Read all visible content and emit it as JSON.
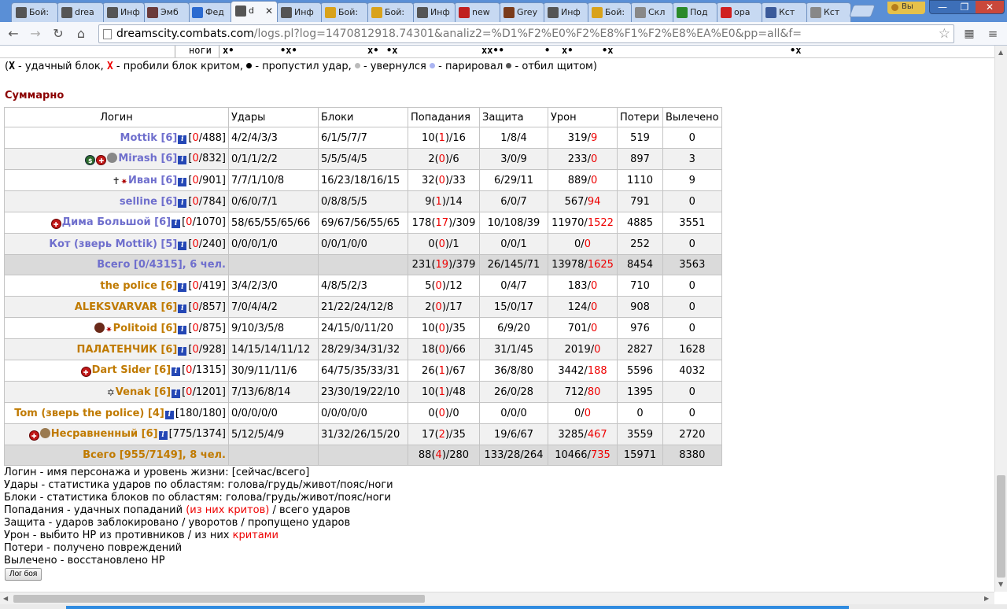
{
  "browser": {
    "tabs": [
      {
        "label": "Бой:",
        "color": "#555"
      },
      {
        "label": "drea",
        "color": "#555"
      },
      {
        "label": "Инф",
        "color": "#555"
      },
      {
        "label": "Эмб",
        "color": "#6b3b3b"
      },
      {
        "label": "Фед",
        "color": "#2a6ad0"
      },
      {
        "label": "d",
        "color": "#555",
        "active": true
      },
      {
        "label": "Инф",
        "color": "#555"
      },
      {
        "label": "Бой:",
        "color": "#d9a21a"
      },
      {
        "label": "Бой:",
        "color": "#d9a21a"
      },
      {
        "label": "Инф",
        "color": "#555"
      },
      {
        "label": "new",
        "color": "#c02020"
      },
      {
        "label": "Grey",
        "color": "#7a3b1b"
      },
      {
        "label": "Инф",
        "color": "#555"
      },
      {
        "label": "Бой:",
        "color": "#d9a21a"
      },
      {
        "label": "Скл",
        "color": "#888"
      },
      {
        "label": "Под",
        "color": "#2a8a2a"
      },
      {
        "label": "opa",
        "color": "#d02020"
      },
      {
        "label": "Кст",
        "color": "#3a5a9a"
      },
      {
        "label": "Кст",
        "color": "#888"
      }
    ],
    "profile_label": "Вы",
    "url_host": "dreamscity.combats.com",
    "url_path": "/logs.pl?log=1470812918.74301&analiz2=%D1%F2%E0%F2%E8%F1%F2%E8%EA%E0&pp=all&f="
  },
  "prev_row": {
    "label": "ноги"
  },
  "legend": {
    "x_bold": "X",
    "t1": " - удачный блок, ",
    "x_red": "X",
    "t2": " - пробили блок критом, ",
    "t3": " - пропустил удар, ",
    "t4": " - увернулся ",
    "t5": " - парировал ",
    "t6": " - отбил щитом)",
    "open": "(",
    "dot_missed": "#000000",
    "dot_dodged": "#bbbbbb",
    "dot_parried": "#aab4f2",
    "dot_shield": "#555555"
  },
  "summary_title": "Суммарно",
  "table": {
    "headers": [
      "Логин",
      "Удары",
      "Блоки",
      "Попадания",
      "Защита",
      "Урон",
      "Потери",
      "Вылечено"
    ],
    "team1": [
      {
        "name": "Mottik [6]",
        "hp_cur": "0",
        "hp_max": "/488]",
        "icons": [],
        "hits": "4/2/4/3/3",
        "blocks": "6/1/5/7/7",
        "pop_a": "10(",
        "pop_c": "1",
        "pop_b": ")/16",
        "def": "1/8/4",
        "dmg_a": "319/",
        "dmg_c": "9",
        "loss": "519",
        "heal": "0"
      },
      {
        "name": "Mirash [6]",
        "hp_cur": "0",
        "hp_max": "/832]",
        "icons": [
          "green",
          "red",
          "grey"
        ],
        "hits": "0/1/1/2/2",
        "blocks": "5/5/5/4/5",
        "pop_a": "2(",
        "pop_c": "0",
        "pop_b": ")/6",
        "def": "3/0/9",
        "dmg_a": "233/",
        "dmg_c": "0",
        "loss": "897",
        "heal": "3"
      },
      {
        "name": "Иван [6]",
        "hp_cur": "0",
        "hp_max": "/901]",
        "icons": [
          "cross",
          "vos"
        ],
        "hits": "7/7/1/10/8",
        "blocks": "16/23/18/16/15",
        "pop_a": "32(",
        "pop_c": "0",
        "pop_b": ")/33",
        "def": "6/29/11",
        "dmg_a": "889/",
        "dmg_c": "0",
        "loss": "1110",
        "heal": "9"
      },
      {
        "name": "selline [6]",
        "hp_cur": "0",
        "hp_max": "/784]",
        "icons": [],
        "hits": "0/6/0/7/1",
        "blocks": "0/8/8/5/5",
        "pop_a": "9(",
        "pop_c": "1",
        "pop_b": ")/14",
        "def": "6/0/7",
        "dmg_a": "567/",
        "dmg_c": "94",
        "loss": "791",
        "heal": "0"
      },
      {
        "name": "Дима Большой [6]",
        "hp_cur": "0",
        "hp_max": "/1070]",
        "icons": [
          "red"
        ],
        "hits": "58/65/55/65/66",
        "blocks": "69/67/56/55/65",
        "pop_a": "178(",
        "pop_c": "17",
        "pop_b": ")/309",
        "def": "10/108/39",
        "dmg_a": "11970/",
        "dmg_c": "1522",
        "loss": "4885",
        "heal": "3551"
      },
      {
        "name": "Кот (зверь Mottik) [5]",
        "hp_cur": "0",
        "hp_max": "/240]",
        "icons": [],
        "hits": "0/0/0/1/0",
        "blocks": "0/0/1/0/0",
        "pop_a": "0(",
        "pop_c": "0",
        "pop_b": ")/1",
        "def": "0/0/1",
        "dmg_a": "0/",
        "dmg_c": "0",
        "loss": "252",
        "heal": "0"
      }
    ],
    "team1_total": {
      "label": "Всего [0/4315], 6 чел.",
      "pop_a": "231(",
      "pop_c": "19",
      "pop_b": ")/379",
      "def": "26/145/71",
      "dmg_a": "13978/",
      "dmg_c": "1625",
      "loss": "8454",
      "heal": "3563"
    },
    "team2": [
      {
        "name": "the police [6]",
        "hp_cur": "0",
        "hp_max": "/419]",
        "icons": [],
        "hits": "3/4/2/3/0",
        "blocks": "4/8/5/2/3",
        "pop_a": "5(",
        "pop_c": "0",
        "pop_b": ")/12",
        "def": "0/4/7",
        "dmg_a": "183/",
        "dmg_c": "0",
        "loss": "710",
        "heal": "0"
      },
      {
        "name": "ALEKSVARVAR [6]",
        "hp_cur": "0",
        "hp_max": "/857]",
        "icons": [],
        "hits": "7/0/4/4/2",
        "blocks": "21/22/24/12/8",
        "pop_a": "2(",
        "pop_c": "0",
        "pop_b": ")/17",
        "def": "15/0/17",
        "dmg_a": "124/",
        "dmg_c": "0",
        "loss": "908",
        "heal": "0"
      },
      {
        "name": "Politoid [6]",
        "hp_cur": "0",
        "hp_max": "/875]",
        "icons": [
          "skull",
          "vos"
        ],
        "hits": "9/10/3/5/8",
        "blocks": "24/15/0/11/20",
        "pop_a": "10(",
        "pop_c": "0",
        "pop_b": ")/35",
        "def": "6/9/20",
        "dmg_a": "701/",
        "dmg_c": "0",
        "loss": "976",
        "heal": "0"
      },
      {
        "name": "ПАЛАТЕНЧИК [6]",
        "hp_cur": "0",
        "hp_max": "/928]",
        "icons": [],
        "hits": "14/15/14/11/12",
        "blocks": "28/29/34/31/32",
        "pop_a": "18(",
        "pop_c": "0",
        "pop_b": ")/66",
        "def": "31/1/45",
        "dmg_a": "2019/",
        "dmg_c": "0",
        "loss": "2827",
        "heal": "1628"
      },
      {
        "name": "Dart Sider [6]",
        "hp_cur": "0",
        "hp_max": "/1315]",
        "icons": [
          "red"
        ],
        "hits": "30/9/11/11/6",
        "blocks": "64/75/35/33/31",
        "pop_a": "26(",
        "pop_c": "1",
        "pop_b": ")/67",
        "def": "36/8/80",
        "dmg_a": "3442/",
        "dmg_c": "188",
        "loss": "5596",
        "heal": "4032"
      },
      {
        "name": "Venak [6]",
        "hp_cur": "0",
        "hp_max": "/1201]",
        "icons": [
          "star"
        ],
        "hits": "7/13/6/8/14",
        "blocks": "23/30/19/22/10",
        "pop_a": "10(",
        "pop_c": "1",
        "pop_b": ")/48",
        "def": "26/0/28",
        "dmg_a": "712/",
        "dmg_c": "80",
        "loss": "1395",
        "heal": "0"
      },
      {
        "name": "Tom (зверь the police) [4]",
        "hp_cur": "",
        "hp_max": "180/180]",
        "icons": [],
        "hits": "0/0/0/0/0",
        "blocks": "0/0/0/0/0",
        "pop_a": "0(",
        "pop_c": "0",
        "pop_b": ")/0",
        "def": "0/0/0",
        "dmg_a": "0/",
        "dmg_c": "0",
        "loss": "0",
        "heal": "0"
      },
      {
        "name": "Несравненный [6]",
        "hp_cur": "",
        "hp_max": "775/1374]",
        "icons": [
          "red",
          "brown"
        ],
        "hits": "5/12/5/4/9",
        "blocks": "31/32/26/15/20",
        "pop_a": "17(",
        "pop_c": "2",
        "pop_b": ")/35",
        "def": "19/6/67",
        "dmg_a": "3285/",
        "dmg_c": "467",
        "loss": "3559",
        "heal": "2720"
      }
    ],
    "team2_total": {
      "label": "Всего [955/7149], 8 чел.",
      "pop_a": "88(",
      "pop_c": "4",
      "pop_b": ")/280",
      "def": "133/28/264",
      "dmg_a": "10466/",
      "dmg_c": "735",
      "loss": "15971",
      "heal": "8380"
    }
  },
  "explain": {
    "l1": "Логин - имя персонажа и уровень жизни: [сейчас/всего]",
    "l2": "Удары - статистика ударов по областям: голова/грудь/живот/пояс/ноги",
    "l3": "Блоки - статистика блоков по областям: голова/грудь/живот/пояс/ноги",
    "l4a": "Попадания - удачных попаданий ",
    "l4b": "(из них критов)",
    "l4c": " / всего ударов",
    "l5": "Защита - ударов заблокировано / уворотов / пропущено ударов",
    "l6a": "Урон - выбито HP из противников / из них ",
    "l6b": "критами",
    "l7": "Потери - получено повреждений",
    "l8": "Вылечено - восстановлено HP"
  },
  "log_button": "Лог боя",
  "colors": {
    "team1": "#6f6fcd",
    "team2": "#c07a00",
    "crit": "#ee0000",
    "summary": "#8b0000"
  }
}
